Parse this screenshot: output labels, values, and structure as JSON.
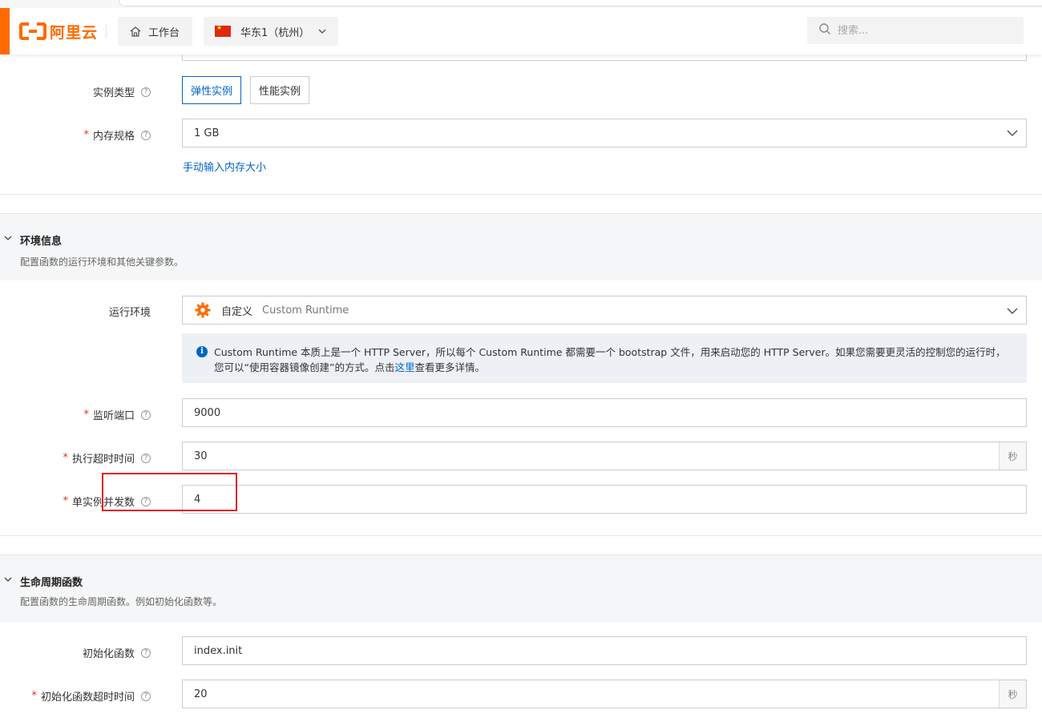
{
  "header": {
    "logo_text": "阿里云",
    "workbench_label": "工作台",
    "region_label": "华东1（杭州）",
    "search_placeholder": "搜索..."
  },
  "instance": {
    "type_label": "实例类型",
    "type_options": [
      "弹性实例",
      "性能实例"
    ],
    "type_selected": "弹性实例",
    "memory_label": "内存规格",
    "memory_value": "1 GB",
    "memory_manual_link": "手动输入内存大小"
  },
  "env_section": {
    "title": "环境信息",
    "description": "配置函数的运行环境和其他关键参数。",
    "runtime_label": "运行环境",
    "runtime_value_main": "自定义",
    "runtime_value_sub": "Custom Runtime",
    "notice_text_1": "Custom Runtime 本质上是一个 HTTP Server，所以每个 Custom Runtime 都需要一个 bootstrap 文件，用来启动您的 HTTP Server。如果您需要更灵活的控制您的运行时，您可以“使用容器镜像创建”的方式。点击",
    "notice_link": "这里",
    "notice_text_2": "查看更多详情。",
    "port_label": "监听端口",
    "port_value": "9000",
    "timeout_label": "执行超时时间",
    "timeout_value": "30",
    "timeout_unit": "秒",
    "concurrency_label": "单实例并发数",
    "concurrency_value": "4"
  },
  "lifecycle_section": {
    "title": "生命周期函数",
    "description": "配置函数的生命周期函数。例如初始化函数等。",
    "init_label": "初始化函数",
    "init_value": "index.init",
    "init_timeout_label": "初始化函数超时时间",
    "init_timeout_value": "20",
    "init_timeout_unit": "秒"
  },
  "colors": {
    "brand": "#ff6a00",
    "link": "#0064c8",
    "required": "#d93026",
    "highlight": "#e02020"
  }
}
